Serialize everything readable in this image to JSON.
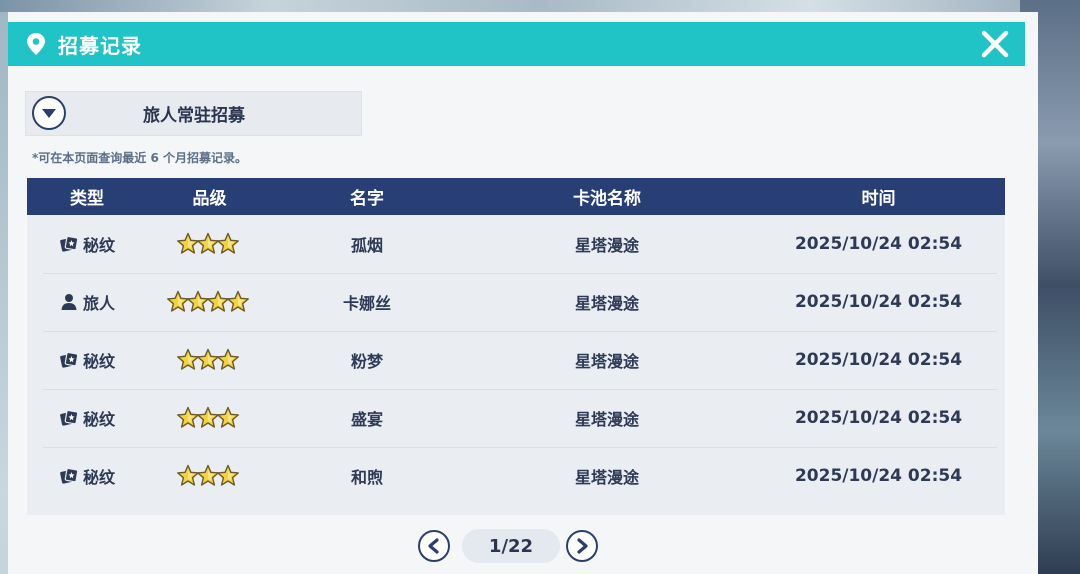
{
  "header": {
    "title": "招募记录",
    "icon": "location-pin-icon",
    "accent": "#20c3c6"
  },
  "dropdown": {
    "label": "旅人常驻招募"
  },
  "note": "*可在本页面查询最近 6 个月招募记录。",
  "table": {
    "columns": [
      "类型",
      "品级",
      "名字",
      "卡池名称",
      "时间"
    ],
    "header_color": "#283f75",
    "rows": [
      {
        "type_icon": "card-icon",
        "type": "秘纹",
        "stars": 3,
        "name": "孤烟",
        "pool": "星塔漫途",
        "time": "2025/10/24 02:54"
      },
      {
        "type_icon": "person-icon",
        "type": "旅人",
        "stars": 4,
        "name": "卡娜丝",
        "pool": "星塔漫途",
        "time": "2025/10/24 02:54"
      },
      {
        "type_icon": "card-icon",
        "type": "秘纹",
        "stars": 3,
        "name": "粉梦",
        "pool": "星塔漫途",
        "time": "2025/10/24 02:54"
      },
      {
        "type_icon": "card-icon",
        "type": "秘纹",
        "stars": 3,
        "name": "盛宴",
        "pool": "星塔漫途",
        "time": "2025/10/24 02:54"
      },
      {
        "type_icon": "card-icon",
        "type": "秘纹",
        "stars": 3,
        "name": "和煦",
        "pool": "星塔漫途",
        "time": "2025/10/24 02:54"
      }
    ]
  },
  "pagination": {
    "label": "1/22"
  }
}
